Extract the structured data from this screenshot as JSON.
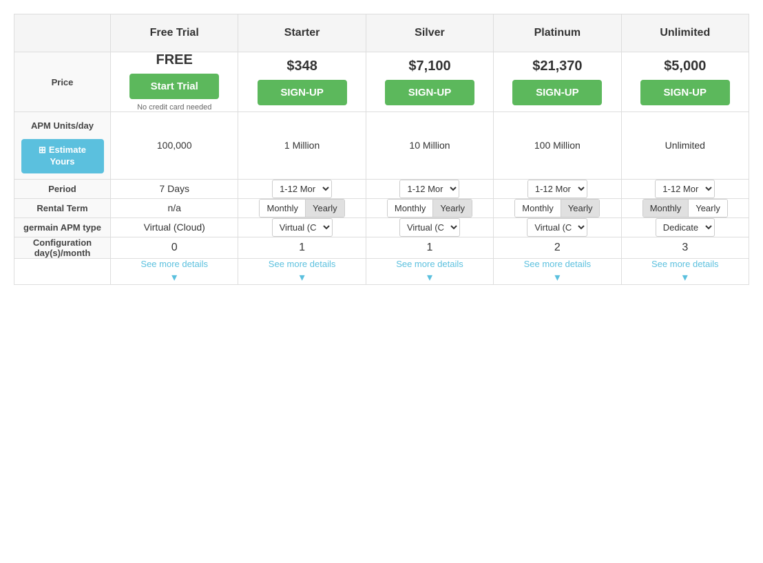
{
  "table": {
    "headers": [
      "",
      "Free Trial",
      "Starter",
      "Silver",
      "Platinum",
      "Unlimited"
    ],
    "rows": {
      "price": {
        "label": "Price",
        "free_trial": {
          "amount": "FREE",
          "button_label": "Start Trial",
          "subtext": "No credit card needed"
        },
        "starter": {
          "amount": "$348",
          "button_label": "SIGN-UP"
        },
        "silver": {
          "amount": "$7,100",
          "button_label": "SIGN-UP"
        },
        "platinum": {
          "amount": "$21,370",
          "button_label": "SIGN-UP"
        },
        "unlimited": {
          "amount": "$5,000",
          "button_label": "SIGN-UP"
        }
      },
      "apm": {
        "label": "APM Units/day",
        "estimate_label": "Estimate\nYours",
        "free_trial": "100,000",
        "starter": "1 Million",
        "silver": "10 Million",
        "platinum": "100 Million",
        "unlimited": "Unlimited"
      },
      "period": {
        "label": "Period",
        "free_trial": "7 Days",
        "options": [
          "1-12 Mor"
        ],
        "starter_selected": "1-12 Mor",
        "silver_selected": "1-12 Mor",
        "platinum_selected": "1-12 Mor",
        "unlimited_selected": "1-12 Mor"
      },
      "rental_term": {
        "label": "Rental Term",
        "free_trial": "n/a",
        "monthly_label": "Monthly",
        "yearly_label": "Yearly"
      },
      "apm_type": {
        "label": "germain APM type",
        "free_trial": "Virtual (Cloud)",
        "starter_selected": "Virtual (C",
        "silver_selected": "Virtual (C",
        "platinum_selected": "Virtual (C",
        "unlimited_selected": "Dedicate",
        "options": [
          "Virtual (C",
          "Dedicate"
        ]
      },
      "config": {
        "label": "Configuration\nday(s)/month",
        "free_trial": "0",
        "starter": "1",
        "silver": "1",
        "platinum": "2",
        "unlimited": "3"
      },
      "details": {
        "label": "",
        "link_text": "See more details",
        "chevron": "▾"
      }
    }
  },
  "icons": {
    "calculator": "⊞",
    "chevron_down": "▾"
  }
}
